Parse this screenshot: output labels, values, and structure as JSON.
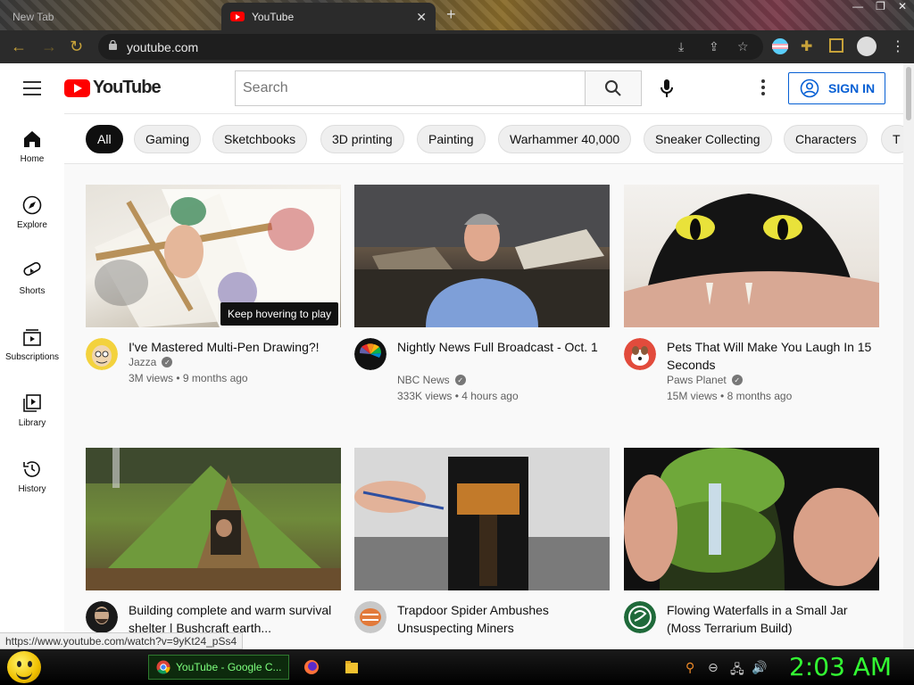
{
  "browser": {
    "tabs": [
      {
        "label": "New Tab",
        "active": false
      },
      {
        "label": "YouTube",
        "active": true
      }
    ],
    "url": "youtube.com",
    "status_url": "https://www.youtube.com/watch?v=9yKt24_pSs4"
  },
  "header": {
    "logo_text": "YouTube",
    "search_placeholder": "Search",
    "signin_label": "SIGN IN"
  },
  "chips": [
    "All",
    "Gaming",
    "Sketchbooks",
    "3D printing",
    "Painting",
    "Warhammer 40,000",
    "Sneaker Collecting",
    "Characters",
    "T"
  ],
  "guide": [
    {
      "label": "Home",
      "icon": "home-icon"
    },
    {
      "label": "Explore",
      "icon": "compass-icon"
    },
    {
      "label": "Shorts",
      "icon": "shorts-icon"
    },
    {
      "label": "Subscriptions",
      "icon": "subscriptions-icon"
    },
    {
      "label": "Library",
      "icon": "library-icon"
    },
    {
      "label": "History",
      "icon": "history-icon"
    }
  ],
  "tooltip": "Keep hovering to play",
  "videos": [
    {
      "title": "I've Mastered Multi-Pen Drawing?!",
      "channel": "Jazza",
      "views": "3M views",
      "age": "9 months ago"
    },
    {
      "title": "Nightly News Full Broadcast - Oct. 1",
      "channel": "NBC News",
      "views": "333K views",
      "age": "4 hours ago"
    },
    {
      "title": "Pets That Will Make You Laugh In 15 Seconds",
      "channel": "Paws Planet",
      "views": "15M views",
      "age": "8 months ago"
    },
    {
      "title": "Building complete and warm survival shelter | Bushcraft earth...",
      "channel": "",
      "views": "",
      "age": ""
    },
    {
      "title": "Trapdoor Spider Ambushes Unsuspecting Miners",
      "channel": "",
      "views": "",
      "age": ""
    },
    {
      "title": "Flowing Waterfalls in a Small Jar (Moss Terrarium Build)",
      "channel": "",
      "views": "",
      "age": ""
    }
  ],
  "taskbar": {
    "app_label": "YouTube - Google C...",
    "clock": "2:03 AM"
  },
  "colors": {
    "accent": "#065fd4",
    "brand": "#ff0000",
    "clock": "#33ff33"
  }
}
